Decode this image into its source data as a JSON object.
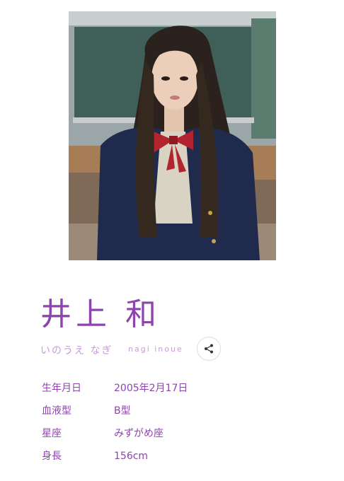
{
  "profile": {
    "name_kanji": "井上 和",
    "name_kana": "いのうえ なぎ",
    "name_romaji": "nagi inoue",
    "share_icon": "share-icon",
    "rows": [
      {
        "label": "生年月日",
        "value": "2005年2月17日"
      },
      {
        "label": "血液型",
        "value": "B型"
      },
      {
        "label": "星座",
        "value": "みずがめ座"
      },
      {
        "label": "身長",
        "value": "156cm"
      }
    ]
  },
  "colors": {
    "accent": "#8e44ad",
    "accent_light": "#c79ad8"
  }
}
